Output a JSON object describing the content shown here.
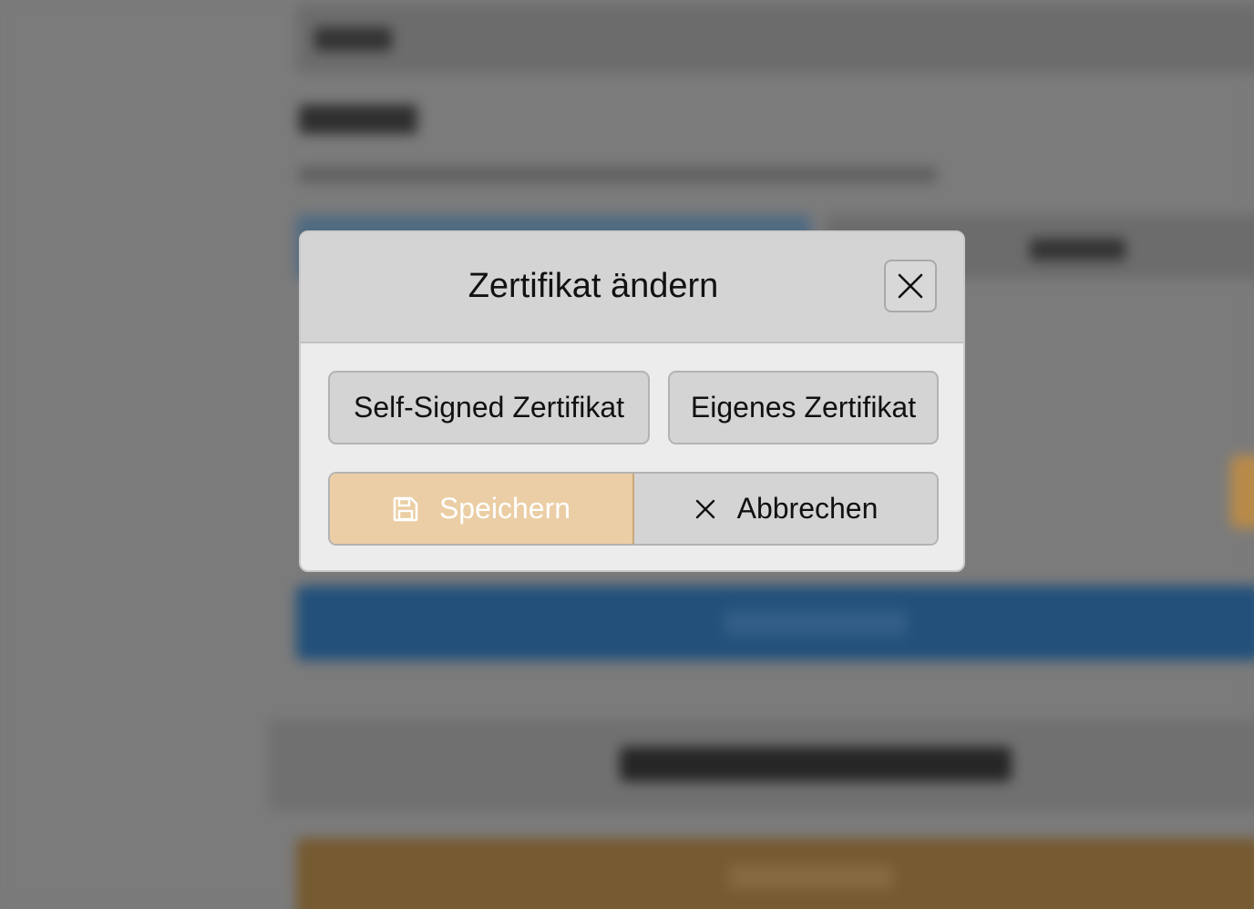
{
  "modal": {
    "title": "Zertifikat ändern",
    "options": [
      {
        "label": "Self-Signed Zertifikat"
      },
      {
        "label": "Eigenes Zertifikat"
      }
    ],
    "save_label": "Speichern",
    "cancel_label": "Abbrechen"
  },
  "colors": {
    "save_button": "#ebcea5",
    "header_bg": "#d4d4d4",
    "body_bg": "#ececec",
    "backdrop": "#7b7b7b"
  },
  "icons": {
    "close": "close-icon",
    "save": "floppy-disk-icon",
    "cancel": "x-icon"
  }
}
